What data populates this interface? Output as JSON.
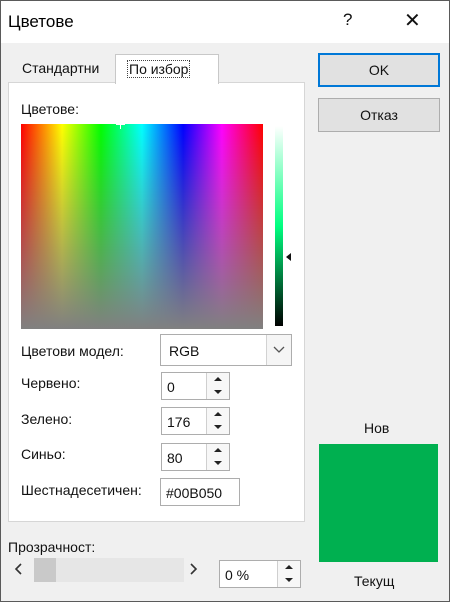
{
  "dialog": {
    "title": "Цветове",
    "help": "?",
    "close": "✕"
  },
  "tabs": [
    {
      "label": "Стандартни"
    },
    {
      "label": "По избор"
    }
  ],
  "colors_label": "Цветове:",
  "model": {
    "label": "Цветови модел:",
    "value": "RGB"
  },
  "red": {
    "label": "Червено:",
    "value": "0"
  },
  "green": {
    "label": "Зелено:",
    "value": "176"
  },
  "blue": {
    "label": "Синьо:",
    "value": "80"
  },
  "hex": {
    "label": "Шестнадесетичен:",
    "value": "#00B050"
  },
  "buttons": {
    "ok": "OK",
    "cancel": "Отказ"
  },
  "preview": {
    "new_label": "Нов",
    "current_label": "Текущ",
    "new_color": "#00B050",
    "current_color": "#00B050"
  },
  "transparency": {
    "label": "Прозрачност:",
    "value": "0 %",
    "level": 0
  },
  "icons": [
    "help-icon",
    "close-icon",
    "chevron-down-icon",
    "chevron-left-icon",
    "chevron-right-icon",
    "spin-up-icon",
    "spin-down-icon"
  ]
}
